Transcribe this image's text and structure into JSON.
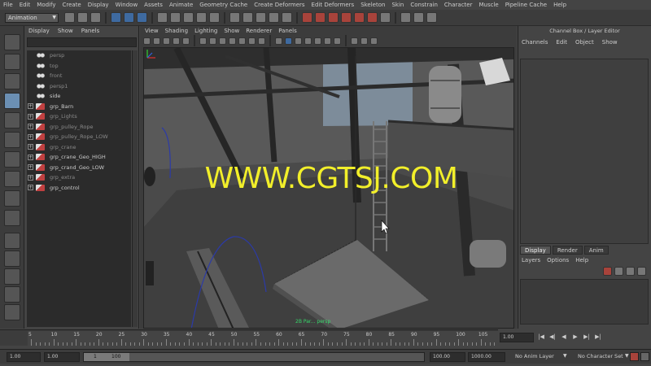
{
  "menubar": {
    "items": [
      "File",
      "Edit",
      "Modify",
      "Create",
      "Display",
      "Window",
      "Assets",
      "Animate",
      "Geometry Cache",
      "Create Deformers",
      "Edit Deformers",
      "Skeleton",
      "Skin",
      "Constrain",
      "Character",
      "Muscle",
      "Pipeline Cache",
      "Help"
    ]
  },
  "statusline": {
    "mode": "Animation"
  },
  "outliner": {
    "menu": [
      "Display",
      "Show",
      "Panels"
    ],
    "items": [
      {
        "label": "persp",
        "kind": "cam",
        "expandable": false,
        "dim": true
      },
      {
        "label": "top",
        "kind": "cam",
        "expandable": false,
        "dim": true
      },
      {
        "label": "front",
        "kind": "cam",
        "expandable": false,
        "dim": true
      },
      {
        "label": "persp1",
        "kind": "cam",
        "expandable": false,
        "dim": true
      },
      {
        "label": "side",
        "kind": "cam",
        "expandable": false,
        "dim": false
      },
      {
        "label": "grp_Barn",
        "kind": "grp",
        "expandable": true,
        "dim": false
      },
      {
        "label": "grp_Lights",
        "kind": "grp",
        "expandable": true,
        "dim": true
      },
      {
        "label": "grp_pulley_Rope",
        "kind": "grp",
        "expandable": true,
        "dim": true
      },
      {
        "label": "grp_pulley_Rope_LOW",
        "kind": "grp",
        "expandable": true,
        "dim": true
      },
      {
        "label": "grp_crane",
        "kind": "grp",
        "expandable": true,
        "dim": true
      },
      {
        "label": "grp_crane_Geo_HIGH",
        "kind": "grp",
        "expandable": true,
        "dim": false
      },
      {
        "label": "grp_crand_Geo_LOW",
        "kind": "grp",
        "expandable": true,
        "dim": false
      },
      {
        "label": "grp_extra",
        "kind": "grp",
        "expandable": true,
        "dim": true
      },
      {
        "label": "grp_control",
        "kind": "grp",
        "expandable": true,
        "dim": false
      }
    ]
  },
  "viewport": {
    "menu": [
      "View",
      "Shading",
      "Lighting",
      "Show",
      "Renderer",
      "Panels"
    ],
    "watermark": "WWW.CGTSJ.COM",
    "camera_label": "2B Par... persp"
  },
  "channelbox": {
    "title": "Channel Box / Layer Editor",
    "menu": [
      "Channels",
      "Edit",
      "Object",
      "Show"
    ],
    "layer_tabs": [
      "Display",
      "Render",
      "Anim"
    ],
    "layer_menu": [
      "Layers",
      "Options",
      "Help"
    ]
  },
  "timeslider": {
    "ticks": [
      "5",
      "10",
      "15",
      "20",
      "25",
      "30",
      "35",
      "40",
      "45",
      "50",
      "55",
      "60",
      "65",
      "70",
      "75",
      "80",
      "85",
      "90",
      "95",
      "100",
      "105"
    ],
    "current_frame": "1.00",
    "transport": [
      "|◀",
      "◀|",
      "◀",
      "▶",
      "▶|",
      "▶|"
    ]
  },
  "rangeslider": {
    "start_time": "1.00",
    "playback_start": "1.00",
    "handle_left": "1",
    "handle_right": "100",
    "playback_end": "100.00",
    "end_time": "1000.00",
    "anim_layer": "No Anim Layer",
    "character_set": "No Character Set"
  }
}
